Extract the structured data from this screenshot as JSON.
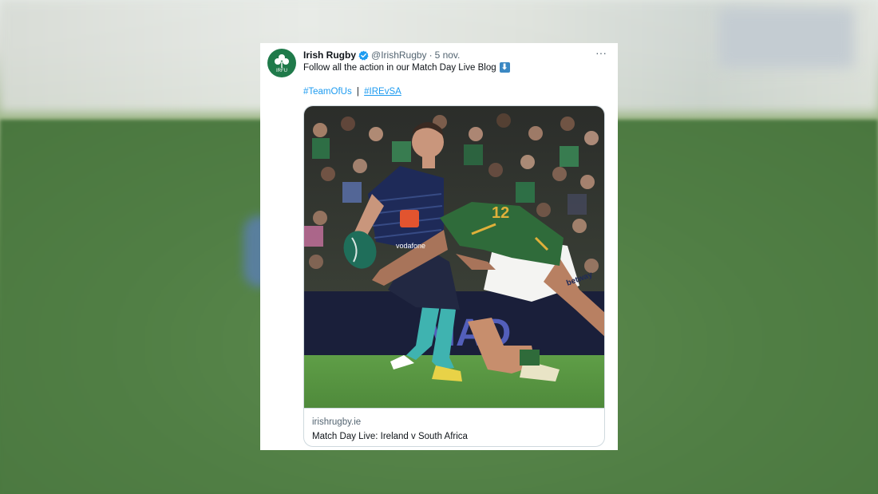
{
  "tweet": {
    "author": {
      "display_name": "Irish Rugby",
      "handle": "@IrishRugby",
      "avatar_text": "IRFU",
      "verified": true
    },
    "separator": "·",
    "date": "5 nov.",
    "more_label": "···",
    "text": "Follow all the action in our Match Day Live Blog",
    "emoji": "⬇",
    "hashtags": [
      "#TeamOfUs",
      "#IREvSA"
    ],
    "hashtag_separator": "|",
    "card": {
      "image_alt": "Rugby player in Ireland kit carrying the ball while tackled by a South Africa player",
      "domain": "irishrugby.ie",
      "title": "Match Day Live: Ireland v South Africa",
      "visible_jersey_text": [
        "12",
        "vodafone",
        "betway"
      ]
    }
  },
  "colors": {
    "link": "#1d9bf0",
    "verified": "#1d9bf0",
    "text_primary": "#0f1419",
    "text_secondary": "#536471",
    "avatar_bg": "#1f7a4a",
    "ireland_kit": "#1e2a58",
    "sa_kit": "#2f6b3a",
    "sa_gold": "#e0b03a",
    "pitch": "#5a9a45"
  }
}
